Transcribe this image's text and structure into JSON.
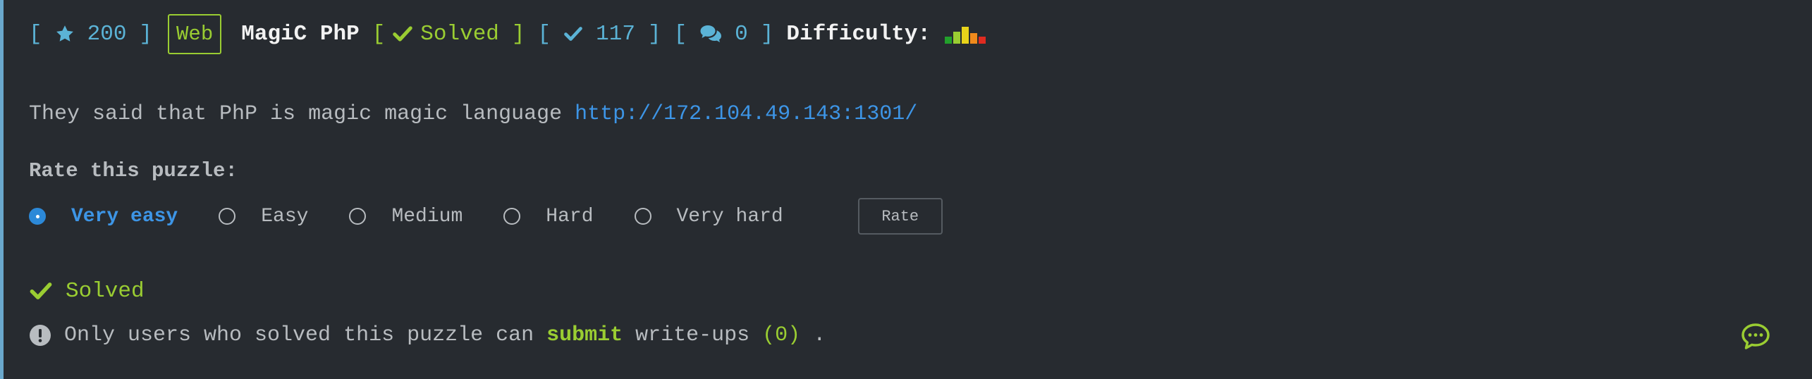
{
  "header": {
    "open_bracket_1": "[",
    "points": "200",
    "close_bracket_1": "]",
    "category": "Web",
    "title": "MagiC PhP",
    "open_bracket_2": "[",
    "status": "Solved",
    "close_bracket_2": "]",
    "open_bracket_3": "[",
    "solves": "117",
    "close_bracket_3": "]",
    "open_bracket_4": "[",
    "comments": "0",
    "close_bracket_4": "]",
    "difficulty_label": "Difficulty:",
    "difficulty_colors": [
      "#22a02b",
      "#9acd32",
      "#e8d31a",
      "#f08a1c",
      "#e02b20"
    ]
  },
  "description": {
    "text": "They said that PhP is magic magic language",
    "url": "http://172.104.49.143:1301/"
  },
  "rating": {
    "title": "Rate this puzzle:",
    "options": [
      "Very easy",
      "Easy",
      "Medium",
      "Hard",
      "Very hard"
    ],
    "selected": "Very easy",
    "button_label": "Rate"
  },
  "solved_label": "Solved",
  "writeups": {
    "prefix": "Only users who solved this puzzle can",
    "link": "submit",
    "middle": "write-ups",
    "count": "(0)",
    "suffix": "."
  },
  "icons": {
    "star": "star-icon",
    "check": "check-icon",
    "comments": "comments-icon",
    "info": "exclamation-circle-icon",
    "chat": "chat-bubble-icon"
  }
}
